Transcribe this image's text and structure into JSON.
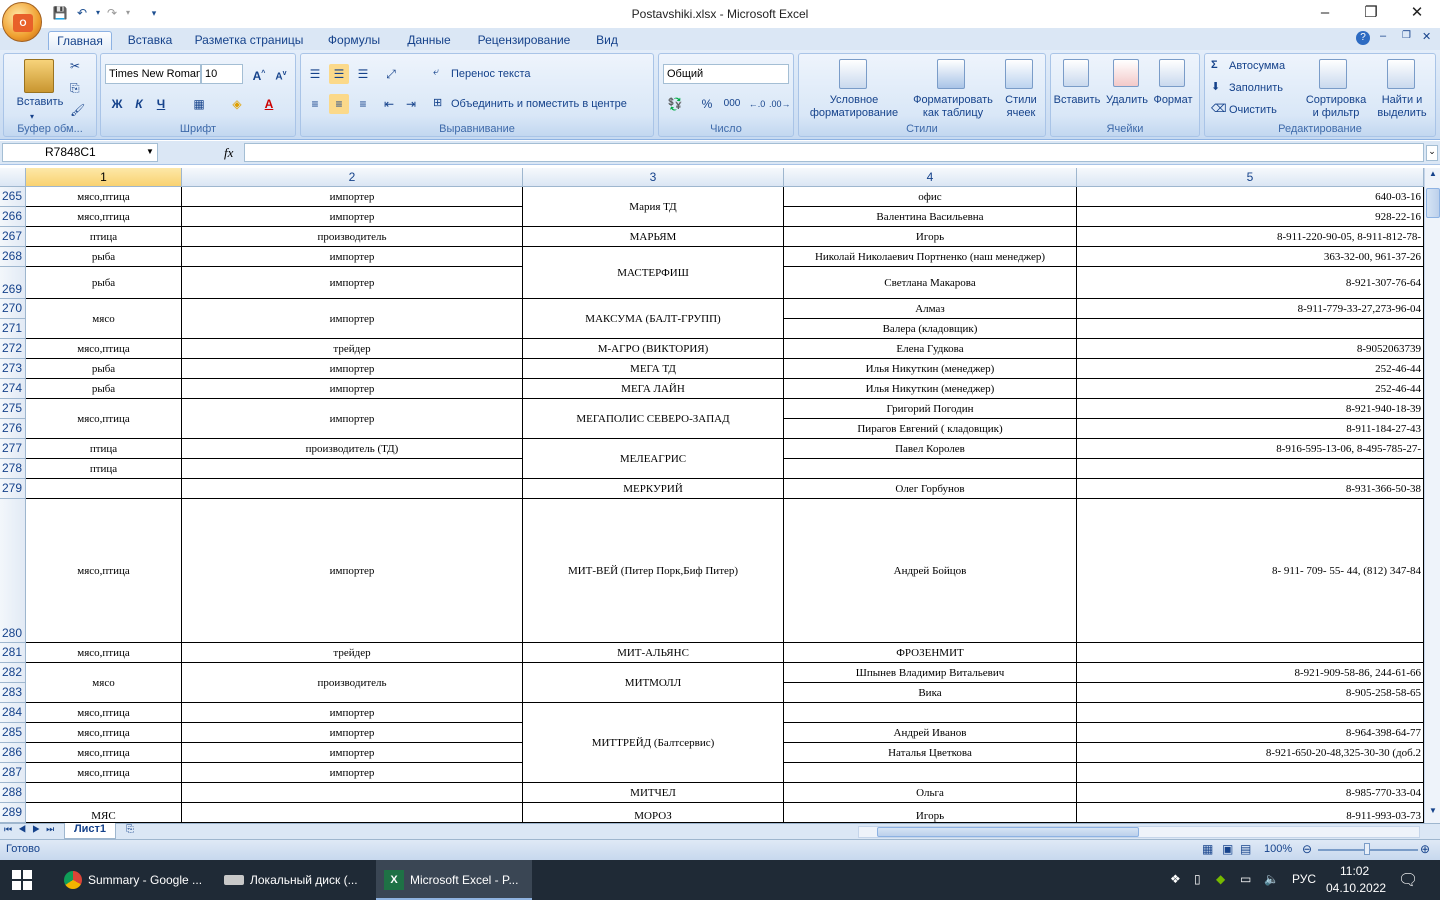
{
  "window": {
    "title": "Postavshiki.xlsx - Microsoft Excel",
    "minimize": "–",
    "restore": "❐",
    "close": "✕"
  },
  "ribbon_tabs": [
    "Главная",
    "Вставка",
    "Разметка страницы",
    "Формулы",
    "Данные",
    "Рецензирование",
    "Вид"
  ],
  "clipboard": {
    "paste": "Вставить",
    "group": "Буфер обм..."
  },
  "font": {
    "name": "Times New Roman",
    "size": "10",
    "bold": "Ж",
    "italic": "К",
    "underline": "Ч",
    "group": "Шрифт"
  },
  "alignment": {
    "wrap": "Перенос текста",
    "merge": "Объединить и поместить в центре",
    "group": "Выравнивание"
  },
  "number": {
    "format": "Общий",
    "percent": "%",
    "thousands": "000",
    "group": "Число"
  },
  "styles": {
    "conditional": "Условное форматирование",
    "conditional_l1": "Условное",
    "conditional_l2": "форматирование",
    "astable_l1": "Форматировать",
    "astable_l2": "как таблицу",
    "cellstyles_l1": "Стили",
    "cellstyles_l2": "ячеек",
    "group": "Стили"
  },
  "cells": {
    "insert": "Вставить",
    "delete": "Удалить",
    "format": "Формат",
    "group": "Ячейки"
  },
  "editing": {
    "autosum": "Автосумма",
    "fill": "Заполнить",
    "clear": "Очистить",
    "sort_l1": "Сортировка",
    "sort_l2": "и фильтр",
    "find_l1": "Найти и",
    "find_l2": "выделить",
    "group": "Редактирование"
  },
  "formula_bar": {
    "name_box": "R7848C1",
    "fx": "fx",
    "value": ""
  },
  "columns": [
    "1",
    "2",
    "3",
    "4",
    "5"
  ],
  "rows": [
    {
      "n": "265",
      "c1": "мясо,птица",
      "c2": "импортер",
      "c4": "офис",
      "c5": "640-03-16"
    },
    {
      "n": "266",
      "c1": "мясо,птица",
      "c2": "импортер",
      "c4": "Валентина Васильевна",
      "c5": "928-22-16"
    },
    {
      "n": "267",
      "c1": "птица",
      "c2": "производитель",
      "c3": "МАРЬЯМ",
      "c4": "Игорь",
      "c5": "8-911-220-90-05, 8-911-812-78-"
    },
    {
      "n": "268",
      "c1": "рыба",
      "c2": "импортер",
      "c4": "Николай Николаевич Портненко (наш менеджер)",
      "c5": "363-32-00, 961-37-26"
    },
    {
      "n": "269",
      "c1": "рыба",
      "c2": "импортер",
      "c4": "Светлана Макарова",
      "c5": "8-921-307-76-64"
    },
    {
      "n": "270",
      "c4": "Алмаз",
      "c5": "8-911-779-33-27,273-96-04"
    },
    {
      "n": "271",
      "c4": "Валера (кладовщик)",
      "c5": ""
    },
    {
      "n": "272",
      "c1": "мясо,птица",
      "c2": "трейдер",
      "c3": "М-АГРО (ВИКТОРИЯ)",
      "c4": "Елена Гудкова",
      "c5": "8-9052063739"
    },
    {
      "n": "273",
      "c1": "рыба",
      "c2": "импортер",
      "c3": "МЕГА ТД",
      "c4": "Илья Никуткин (менеджер)",
      "c5": "252-46-44"
    },
    {
      "n": "274",
      "c1": "рыба",
      "c2": "импортер",
      "c3": "МЕГА ЛАЙН",
      "c4": "Илья Никуткин (менеджер)",
      "c5": "252-46-44"
    },
    {
      "n": "275",
      "c4": "Григорий Погодин",
      "c5": "8-921-940-18-39"
    },
    {
      "n": "276",
      "c4": "Пирагов Евгений ( кладовщик)",
      "c5": "8-911-184-27-43"
    },
    {
      "n": "277",
      "c1": "птица",
      "c2": "производитель (ТД)",
      "c4": "Павел Королев",
      "c5": "8-916-595-13-06, 8-495-785-27-"
    },
    {
      "n": "278",
      "c1": "птица",
      "c2": "",
      "c4": "",
      "c5": ""
    },
    {
      "n": "279",
      "c1": "",
      "c2": "",
      "c3": "МЕРКУРИЙ",
      "c4": "Олег Горбунов",
      "c5": "8-931-366-50-38"
    },
    {
      "n": "280",
      "c1": "мясо,птица",
      "c2": "импортер",
      "c3": "МИТ-ВЕЙ (Питер Порк,Биф Питер)",
      "c4": "Андрей Бойцов",
      "c5": "8- 911- 709- 55- 44, (812) 347-84"
    },
    {
      "n": "281",
      "c1": "мясо,птица",
      "c2": "трейдер",
      "c3": "МИТ-АЛЬЯНС",
      "c4": "ФРОЗЕНМИТ",
      "c5": ""
    },
    {
      "n": "282",
      "c4": "Шпынев Владимир Витальевич",
      "c5": "8-921-909-58-86, 244-61-66"
    },
    {
      "n": "283",
      "c4": "Вика",
      "c5": "8-905-258-58-65"
    },
    {
      "n": "284",
      "c1": "мясо,птица",
      "c2": "импортер",
      "c4": "",
      "c5": ""
    },
    {
      "n": "285",
      "c1": "мясо,птица",
      "c2": "импортер",
      "c4": "Андрей Иванов",
      "c5": "8-964-398-64-77"
    },
    {
      "n": "286",
      "c1": "мясо,птица",
      "c2": "импортер",
      "c4": "Наталья Цветкова",
      "c5": "8-921-650-20-48,325-30-30 (доб.2"
    },
    {
      "n": "287",
      "c1": "мясо,птица",
      "c2": "импортер",
      "c4": "",
      "c5": ""
    },
    {
      "n": "288",
      "c1": "",
      "c2": "",
      "c3": "МИТЧЕЛ",
      "c4": "Ольга",
      "c5": "8-985-770-33-04"
    },
    {
      "n": "289",
      "c1": "МЯС",
      "c2": "",
      "c3": "МОРОЗ",
      "c4": "Игорь",
      "c5": "8-911-993-03-73"
    }
  ],
  "merged": {
    "maria": "Мария ТД",
    "masterfish": "МАСТЕРФИШ",
    "maksuma": "МАКСУМА (БАЛТ-ГРУПП)",
    "maksuma_c1": "мясо",
    "maksuma_c2": "импортер",
    "megapolis": "МЕГАПОЛИС СЕВЕРО-ЗАПАД",
    "megapolis_c1": "мясо,птица",
    "megapolis_c2": "импортер",
    "meleagris": "МЕЛЕАГРИС",
    "mitmoll": "МИТМОЛЛ",
    "mitmoll_c1": "мясо",
    "mitmoll_c2": "производитель",
    "mittreid": "МИТТРЕЙД (Балтсервис)"
  },
  "sheet_tab": "Лист1",
  "status": {
    "ready": "Готово",
    "zoom": "100%"
  },
  "taskbar": {
    "apps": [
      "Summary - Google ...",
      "Локальный диск (...",
      "Microsoft Excel - P..."
    ],
    "lang": "РУС",
    "time": "11:02",
    "date": "04.10.2022"
  }
}
